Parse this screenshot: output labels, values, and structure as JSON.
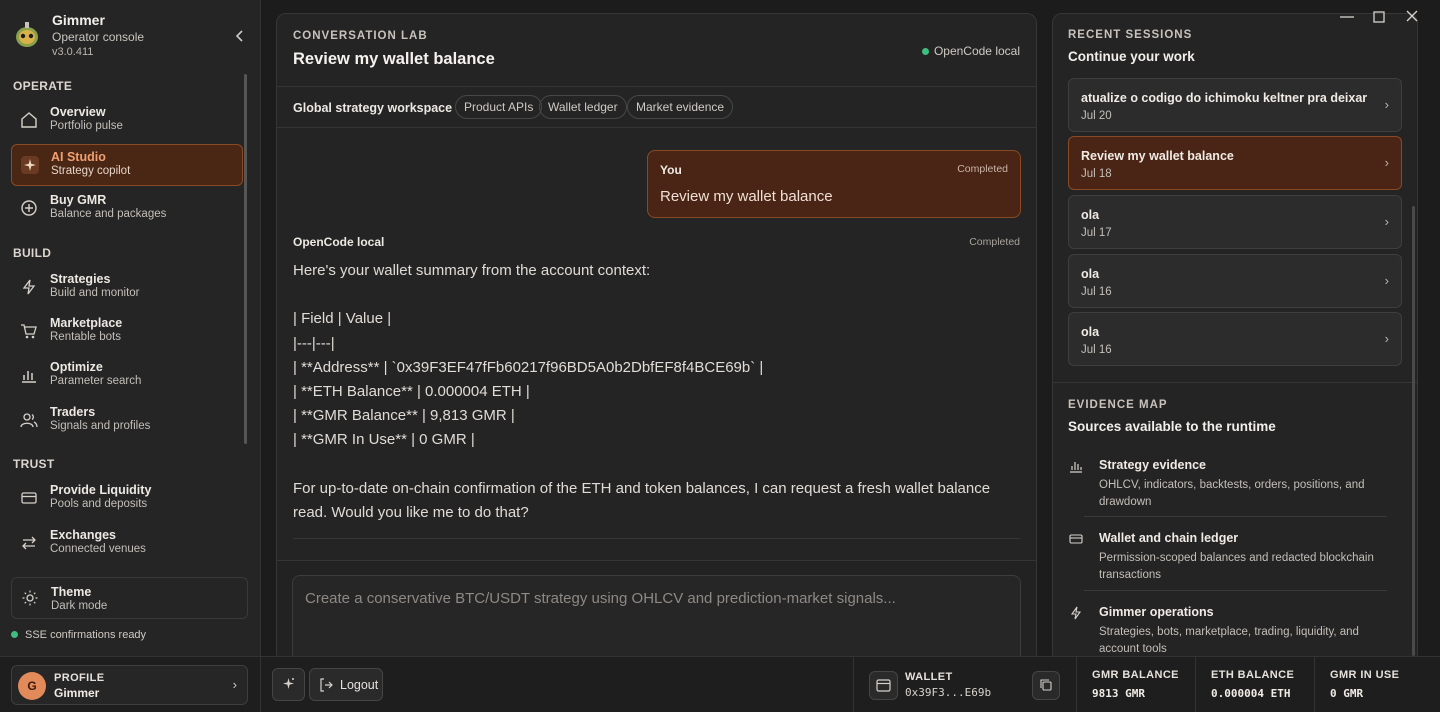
{
  "window": {
    "controls": [
      "minimize",
      "maximize",
      "close"
    ]
  },
  "brand": {
    "name": "Gimmer",
    "subtitle": "Operator console",
    "version": "v3.0.411"
  },
  "sidebar": {
    "sections": {
      "operate": "OPERATE",
      "build": "BUILD",
      "trust": "TRUST"
    },
    "items": [
      {
        "title": "Overview",
        "sub": "Portfolio pulse",
        "icon": "home-icon",
        "active": false
      },
      {
        "title": "AI Studio",
        "sub": "Strategy copilot",
        "icon": "sparkle-icon",
        "active": true
      },
      {
        "title": "Buy GMR",
        "sub": "Balance and packages",
        "icon": "plus-circle-icon",
        "active": false
      },
      {
        "title": "Strategies",
        "sub": "Build and monitor",
        "icon": "bolt-icon",
        "active": false
      },
      {
        "title": "Marketplace",
        "sub": "Rentable bots",
        "icon": "cart-icon",
        "active": false
      },
      {
        "title": "Optimize",
        "sub": "Parameter search",
        "icon": "bar-chart-icon",
        "active": false
      },
      {
        "title": "Traders",
        "sub": "Signals and profiles",
        "icon": "users-icon",
        "active": false
      },
      {
        "title": "Provide Liquidity",
        "sub": "Pools and deposits",
        "icon": "card-icon",
        "active": false
      },
      {
        "title": "Exchanges",
        "sub": "Connected venues",
        "icon": "swap-icon",
        "active": false
      }
    ],
    "theme": {
      "title": "Theme",
      "sub": "Dark mode"
    },
    "sse_status": "SSE confirmations ready"
  },
  "conversation": {
    "label": "CONVERSATION LAB",
    "title": "Review my wallet balance",
    "runtime_status": "OpenCode local",
    "workspace_label": "Global strategy workspace",
    "chips": [
      "Product APIs",
      "Wallet ledger",
      "Market evidence"
    ],
    "user_message": {
      "author": "You",
      "status": "Completed",
      "text": "Review my wallet balance"
    },
    "bot_message": {
      "author": "OpenCode local",
      "status": "Completed",
      "lines": [
        "Here's your wallet summary from the account context:",
        "",
        "| Field | Value |",
        "|---|---|",
        "| **Address** | `0x39F3EF47fFb60217f96BD5A0b2DbfEF8f4BCE69b` |",
        "| **ETH Balance** | 0.000004 ETH |",
        "| **GMR Balance** | 9,813 GMR |",
        "| **GMR In Use** | 0 GMR |",
        ""
      ],
      "closing": "For up-to-date on-chain confirmation of the ETH and token balances, I can request a fresh wallet balance read. Would you like me to do that?"
    },
    "composer_placeholder": "Create a conservative BTC/USDT strategy using OHLCV and prediction-market signals..."
  },
  "recent_sessions": {
    "label": "RECENT SESSIONS",
    "title": "Continue your work",
    "items": [
      {
        "title": "atualize o codigo do ichimoku keltner pra deixar",
        "date": "Jul 20",
        "active": false
      },
      {
        "title": "Review my wallet balance",
        "date": "Jul 18",
        "active": true
      },
      {
        "title": "ola",
        "date": "Jul 17",
        "active": false
      },
      {
        "title": "ola",
        "date": "Jul 16",
        "active": false
      },
      {
        "title": "ola",
        "date": "Jul 16",
        "active": false
      }
    ]
  },
  "evidence_map": {
    "label": "EVIDENCE MAP",
    "title": "Sources available to the runtime",
    "items": [
      {
        "title": "Strategy evidence",
        "desc": "OHLCV, indicators, backtests, orders, positions, and drawdown",
        "icon": "bar-chart-icon"
      },
      {
        "title": "Wallet and chain ledger",
        "desc": "Permission-scoped balances and redacted blockchain transactions",
        "icon": "card-icon"
      },
      {
        "title": "Gimmer operations",
        "desc": "Strategies, bots, marketplace, trading, liquidity, and account tools",
        "icon": "bolt-icon"
      }
    ]
  },
  "footer": {
    "profile": {
      "label": "PROFILE",
      "name": "Gimmer",
      "initial": "G"
    },
    "logout_label": "Logout",
    "wallet": {
      "label": "WALLET",
      "address": "0x39F3...E69b"
    },
    "stats": [
      {
        "label": "GMR BALANCE",
        "value": "9813 GMR"
      },
      {
        "label": "ETH BALANCE",
        "value": "0.000004 ETH"
      },
      {
        "label": "GMR IN USE",
        "value": "0 GMR"
      }
    ]
  },
  "colors": {
    "accent": "#f0a070",
    "active_bg": "#4a2414",
    "status_green": "#3fbf7f"
  }
}
